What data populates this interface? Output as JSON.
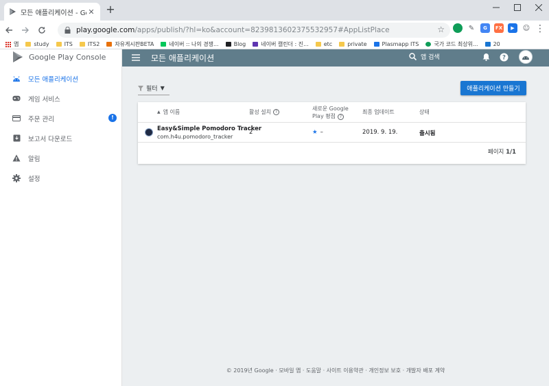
{
  "browser": {
    "tab_title": "모든 애플리케이션 - Google Pl",
    "url_host": "play.google.com",
    "url_path": "/apps/publish/?hl=ko&account=8239813602375532957#AppListPlace",
    "bookmarks": [
      {
        "label": "앱",
        "icon": "apps-grid-icon"
      },
      {
        "label": "study",
        "icon": "folder-icon"
      },
      {
        "label": "ITS",
        "icon": "folder-icon"
      },
      {
        "label": "ITS2",
        "icon": "folder-icon"
      },
      {
        "label": "자유게시판BETA",
        "icon": "site-icon"
      },
      {
        "label": "네이버 :: 나의 경쟁...",
        "icon": "naver-icon"
      },
      {
        "label": "Blog",
        "icon": "blog-icon"
      },
      {
        "label": "네이버 캘린더 : 진...",
        "icon": "calendar-icon"
      },
      {
        "label": "etc",
        "icon": "folder-icon"
      },
      {
        "label": "private",
        "icon": "folder-icon"
      },
      {
        "label": "Plasmapp ITS",
        "icon": "site-icon"
      },
      {
        "label": "국가 코드 최상위...",
        "icon": "site-icon"
      },
      {
        "label": "20",
        "icon": "site-icon"
      }
    ]
  },
  "console": {
    "logo_brand": "Google Play",
    "logo_product": "Console",
    "nav": [
      {
        "label": "모든 애플리케이션",
        "icon": "android-icon",
        "active": true
      },
      {
        "label": "게임 서비스",
        "icon": "gamepad-icon"
      },
      {
        "label": "주문 관리",
        "icon": "credit-card-icon",
        "badge": "!"
      },
      {
        "label": "보고서 다운로드",
        "icon": "download-box-icon"
      },
      {
        "label": "알림",
        "icon": "warning-icon"
      },
      {
        "label": "설정",
        "icon": "gear-icon"
      }
    ],
    "header_title": "모든 애플리케이션",
    "search_label": "앱 검색",
    "filter_label": "필터",
    "create_button": "애플리케이션 만들기",
    "columns": {
      "app_name": "앱 이름",
      "installs": "활성 설치",
      "rating_line1": "새로운 Google",
      "rating_line2": "Play 평점",
      "updated": "최종 업데이트",
      "status": "상태"
    },
    "apps": [
      {
        "name": "Easy&Simple Pomodoro Tracker",
        "package": "com.h4u.pomodoro_tracker",
        "installs": "2",
        "rating": "–",
        "updated": "2019. 9. 19.",
        "status": "출시됨"
      }
    ],
    "pager_label": "페이지",
    "pager_value": "1/1",
    "footer": "© 2019년 Google · 모바일 앱 · 도움말 · 사이트 이용약관 · 개인정보 보호 · 개발자 배포 계약"
  }
}
